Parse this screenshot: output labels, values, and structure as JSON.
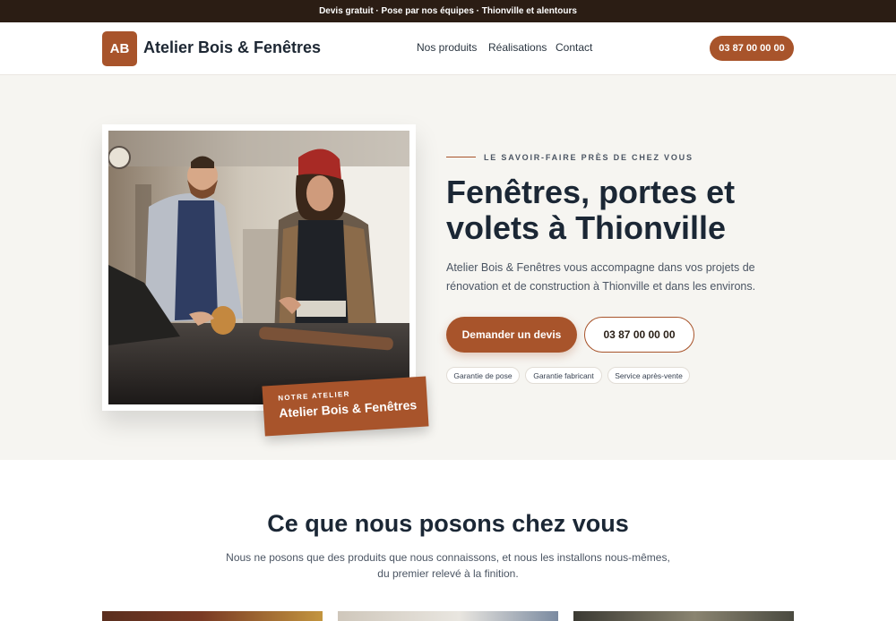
{
  "topbar": {
    "text": "Devis gratuit · Pose par nos équipes · Thionville et alentours"
  },
  "header": {
    "logo_initials": "AB",
    "brand": "Atelier Bois & Fenêtres",
    "nav": [
      "Nos produits",
      "Réalisations",
      "Contact"
    ],
    "phone": "03 87 00 00 00"
  },
  "hero": {
    "image_label": {
      "kicker": "NOTRE ATELIER",
      "name": "Atelier Bois & Fenêtres"
    },
    "eyebrow": "LE SAVOIR-FAIRE PRÈS DE CHEZ VOUS",
    "title": "Fenêtres, portes et volets à Thionville",
    "text": "Atelier Bois & Fenêtres vous accompagne dans vos projets de rénovation et de construction à Thionville et dans les environs.",
    "cta_primary": "Demander un devis",
    "cta_phone": "03 87 00 00 00",
    "badges": [
      "Garantie de pose",
      "Garantie fabricant",
      "Service après-vente"
    ]
  },
  "products": {
    "title": "Ce que nous posons chez vous",
    "text": "Nous ne posons que des produits que nous connaissons, et nous les installons nous-mêmes, du premier relevé à la finition."
  },
  "colors": {
    "accent": "#a8542b",
    "topbar": "#2b1d14",
    "hero_bg": "#f6f5f1",
    "heading": "#1b2735"
  }
}
